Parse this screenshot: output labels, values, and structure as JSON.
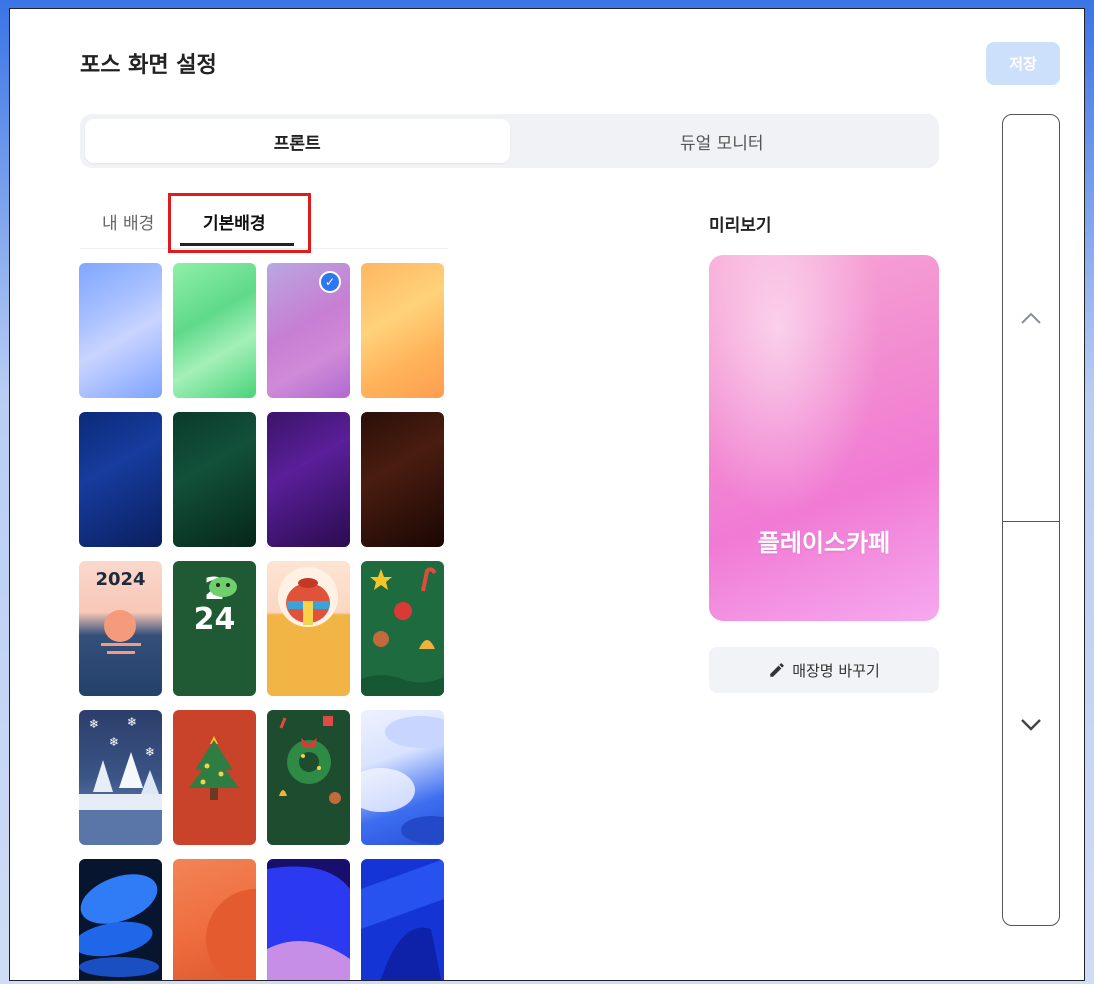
{
  "header": {
    "title": "포스 화면 설정",
    "save_label": "저장"
  },
  "display_tabs": [
    {
      "label": "프론트",
      "active": true
    },
    {
      "label": "듀얼 모니터",
      "active": false
    }
  ],
  "background_tabs": [
    {
      "label": "내 배경",
      "active": false
    },
    {
      "label": "기본배경",
      "active": true
    }
  ],
  "thumbnails": [
    {
      "name": "pastel-blue",
      "selected": false
    },
    {
      "name": "pastel-green",
      "selected": false
    },
    {
      "name": "pastel-purple",
      "selected": true
    },
    {
      "name": "pastel-orange",
      "selected": false
    },
    {
      "name": "dark-blue",
      "selected": false
    },
    {
      "name": "dark-green",
      "selected": false
    },
    {
      "name": "dark-purple",
      "selected": false
    },
    {
      "name": "dark-brown",
      "selected": false
    },
    {
      "name": "sunset-2024",
      "text": "2024",
      "selected": false
    },
    {
      "name": "dragon-2024",
      "text": "2\n24",
      "selected": false
    },
    {
      "name": "lucky-bag",
      "selected": false
    },
    {
      "name": "christmas-ornaments",
      "selected": false
    },
    {
      "name": "snowy-trees",
      "selected": false
    },
    {
      "name": "christmas-tree",
      "selected": false
    },
    {
      "name": "christmas-wreath",
      "selected": false
    },
    {
      "name": "blue-waves-light",
      "selected": false
    },
    {
      "name": "blue-discs-dark",
      "selected": false
    },
    {
      "name": "orange-abstract",
      "selected": false
    },
    {
      "name": "indigo-abstract",
      "selected": false
    },
    {
      "name": "blue-abstract",
      "selected": false
    }
  ],
  "preview": {
    "label": "미리보기",
    "store_name": "플레이스카페"
  },
  "rename_button": {
    "label": "매장명 바꾸기"
  },
  "colors": {
    "accent": "#2f76f0",
    "save_disabled": "#cde0fb",
    "highlight": "#e01b1b"
  }
}
